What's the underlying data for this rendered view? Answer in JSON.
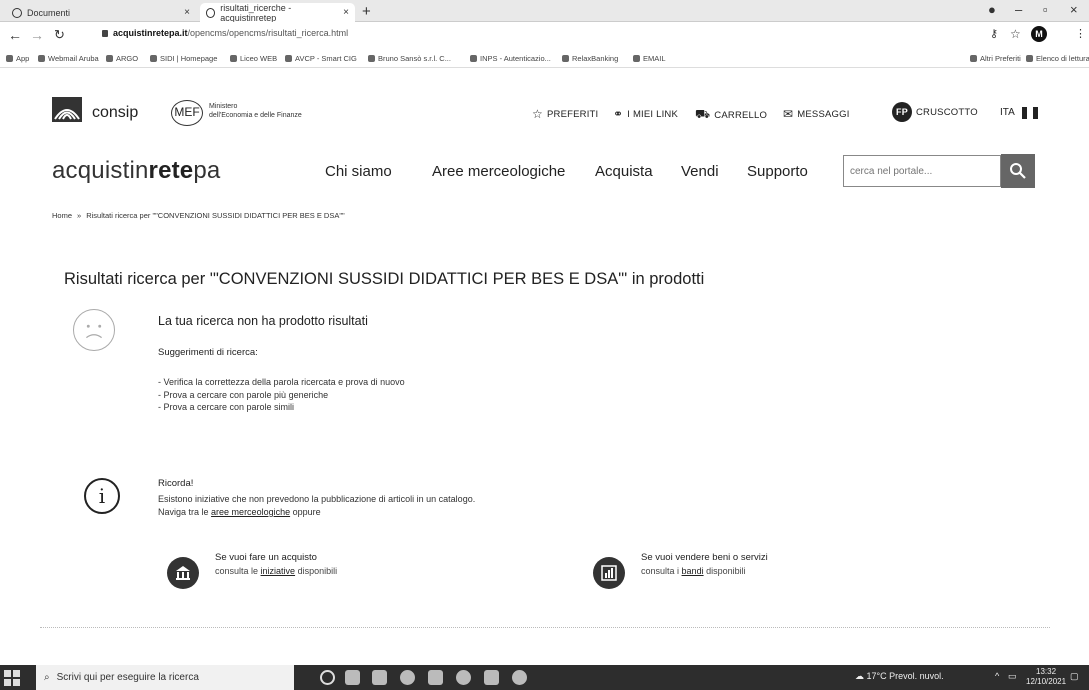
{
  "browser": {
    "tabs": [
      {
        "title": "Documenti"
      },
      {
        "title": "risultati_ricerche - acquistinretep"
      }
    ],
    "url_host": "acquistinretepa.it",
    "url_path": "/opencms/opencms/risultati_ricerca.html",
    "profile_initial": "M",
    "bookmarks": [
      "App",
      "Webmail Aruba",
      "ARGO",
      "SIDI | Homepage",
      "Liceo WEB",
      "AVCP - Smart CIG",
      "Bruno Sansò s.r.l. C...",
      "INPS - Autenticazio...",
      "RelaxBanking",
      "EMAIL",
      "Altri Preferiti",
      "Elenco di lettura"
    ]
  },
  "header": {
    "consip": "consip",
    "mef": "MEF",
    "mef_line1": "Ministero",
    "mef_line2": "dell'Economia e delle Finanze",
    "links": {
      "preferiti": "PREFERITI",
      "link": "I MIEI LINK",
      "carrello": "CARRELLO",
      "messaggi": "MESSAGGI",
      "fp": "FP",
      "cruscotto": "CRUSCOTTO"
    },
    "lang": "ITA",
    "brand_prefix": "acquistin",
    "brand_bold": "rete",
    "brand_suffix": "pa",
    "nav": [
      "Chi siamo",
      "Aree merceologiche",
      "Acquista",
      "Vendi",
      "Supporto"
    ],
    "search_placeholder": "cerca nel portale..."
  },
  "breadcrumb": {
    "home": "Home",
    "sep": "»",
    "current": "Risultati ricerca per \"\"CONVENZIONI SUSSIDI DIDATTICI PER BES E DSA\"\""
  },
  "main": {
    "title": "Risultati ricerca per '\"CONVENZIONI SUSSIDI DIDATTICI PER BES E DSA\"' in prodotti",
    "noresult": "La tua ricerca non ha prodotto risultati",
    "sugg_title": "Suggerimenti di ricerca:",
    "suggestions": [
      "- Verifica la correttezza della parola ricercata e prova di nuovo",
      "- Prova a cercare con parole più generiche",
      "- Prova a cercare con parole simili"
    ],
    "ricorda_title": "Ricorda!",
    "ricorda_line1": "Esistono iniziative che non prevedono la pubblicazione di articoli in un catalogo.",
    "ricorda_line2_pre": "Naviga tra le",
    "ricorda_link": "aree merceologiche",
    "ricorda_line2_post": "oppure",
    "buy_title": "Se vuoi fare un acquisto",
    "buy_pre": "consulta le",
    "buy_link": "iniziative",
    "buy_post": "disponibili",
    "sell_title": "Se vuoi vendere beni o servizi",
    "sell_pre": "consulta i",
    "sell_link": "bandi",
    "sell_post": "disponibili"
  },
  "taskbar": {
    "search_placeholder": "Scrivi qui per eseguire la ricerca",
    "weather": "17°C Prevol. nuvol.",
    "time": "13:32",
    "date": "12/10/2021"
  }
}
